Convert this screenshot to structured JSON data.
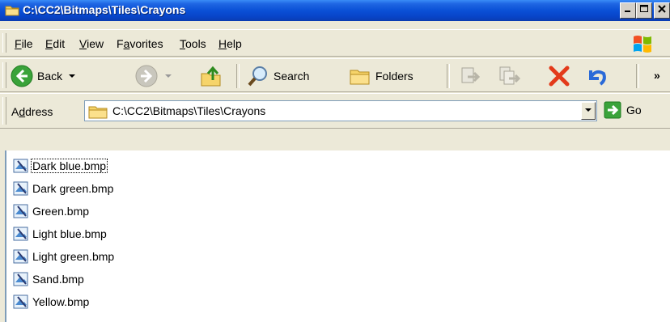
{
  "window": {
    "title": "C:\\CC2\\Bitmaps\\Tiles\\Crayons",
    "controls": {
      "minimize": "_",
      "maximize": "□",
      "close": "✕"
    }
  },
  "menu": {
    "items": [
      {
        "accel": "F",
        "rest": "ile"
      },
      {
        "accel": "E",
        "rest": "dit"
      },
      {
        "accel": "V",
        "rest": "iew"
      },
      {
        "pre": "F",
        "accel": "a",
        "rest": "vorites"
      },
      {
        "accel": "T",
        "rest": "ools"
      },
      {
        "accel": "H",
        "rest": "elp"
      }
    ]
  },
  "toolbar": {
    "back_label": "Back",
    "search_label": "Search",
    "folders_label": "Folders",
    "chevron": "»"
  },
  "address": {
    "label_pre": "A",
    "label_accel": "d",
    "label_rest": "dress",
    "value": "C:\\CC2\\Bitmaps\\Tiles\\Crayons",
    "go_label": "Go"
  },
  "files": [
    "Dark blue.bmp",
    "Dark green.bmp",
    "Green.bmp",
    "Light blue.bmp",
    "Light green.bmp",
    "Sand.bmp",
    "Yellow.bmp"
  ],
  "colors": {
    "titlebar": "#0a50d6",
    "back_arrow": "#3aa33a",
    "delete_x": "#e33a1a",
    "undo": "#2a6ad8"
  }
}
